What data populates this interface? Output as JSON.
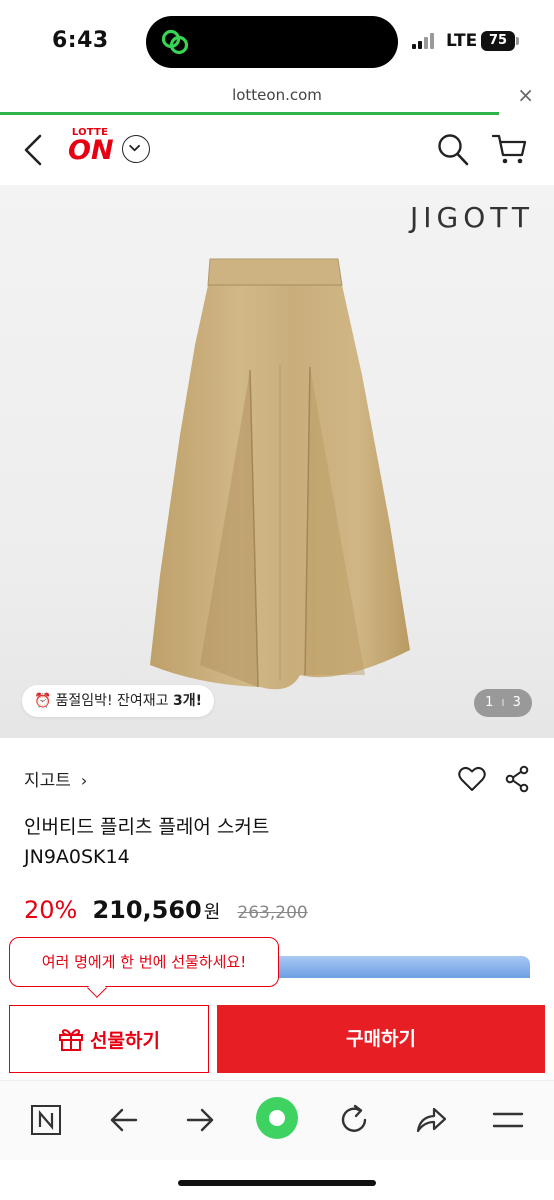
{
  "status_bar": {
    "time": "6:43",
    "network": "LTE",
    "battery": "75"
  },
  "browser": {
    "url": "lotteon.com",
    "close_label": "×",
    "page_load_progress": 0.9
  },
  "header": {
    "logo_top": "LOTTE",
    "logo_main": "ON"
  },
  "gallery": {
    "brand_logo": "JIGOTT",
    "stock_prefix": "품절임박! 잔여재고 ",
    "stock_count": "3개!",
    "page_current": "1",
    "page_separator": "I",
    "page_total": "3"
  },
  "product": {
    "brand": "지고트",
    "brand_chevron": "›",
    "name": "인버티드 플리츠 플레어 스커트",
    "code": "JN9A0SK14",
    "discount": "20%",
    "price": "210,560",
    "currency": "원",
    "original_price": "263,200"
  },
  "actions": {
    "gift_tooltip": "여러 명에게 한 번에 선물하세요!",
    "gift_label": "선물하기",
    "buy_label": "구매하기"
  },
  "colors": {
    "brand_red": "#e60012",
    "progress_green": "#2db34a",
    "skirt_beige": "#c9b07e"
  },
  "icons": [
    "back-icon",
    "dropdown-icon",
    "search-icon",
    "cart-icon",
    "heart-icon",
    "share-icon",
    "gift-icon",
    "naver-n-icon",
    "back-arrow-icon",
    "forward-arrow-icon",
    "green-circle-icon",
    "refresh-icon",
    "share-arrow-icon",
    "menu-icon"
  ]
}
